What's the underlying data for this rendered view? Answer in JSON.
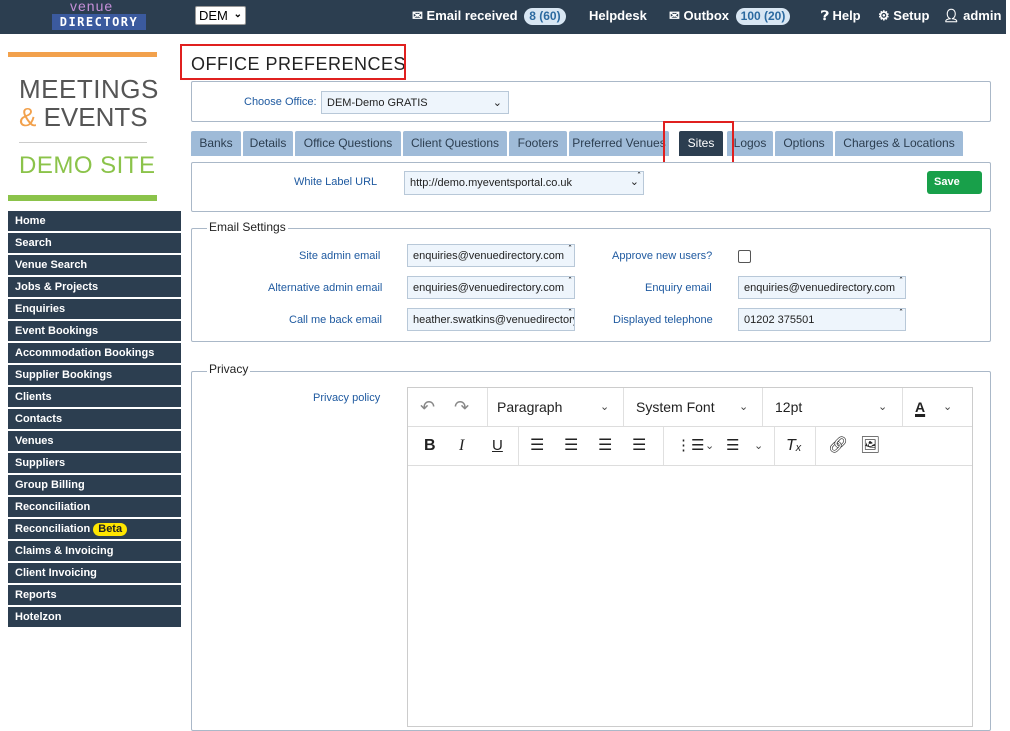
{
  "topbar": {
    "logo_line1": "venue",
    "logo_line2": "DIRECTORY",
    "office_code": "DEM",
    "email_received_label": "Email received",
    "email_received_count": "8 (60)",
    "helpdesk_label": "Helpdesk",
    "outbox_label": "Outbox",
    "outbox_count": "100 (20)",
    "help_label": "Help",
    "setup_label": "Setup",
    "admin_label": "admin"
  },
  "brand": {
    "line1": "MEETINGS",
    "amp": "&",
    "line2": "EVENTS",
    "line3": "DEMO SITE"
  },
  "sidebar": {
    "items": [
      {
        "label": "Home"
      },
      {
        "label": "Search"
      },
      {
        "label": "Venue Search"
      },
      {
        "label": "Jobs & Projects"
      },
      {
        "label": "Enquiries"
      },
      {
        "label": "Event Bookings"
      },
      {
        "label": "Accommodation Bookings"
      },
      {
        "label": "Supplier Bookings"
      },
      {
        "label": "Clients"
      },
      {
        "label": "Contacts"
      },
      {
        "label": "Venues"
      },
      {
        "label": "Suppliers"
      },
      {
        "label": "Group Billing"
      },
      {
        "label": "Reconciliation"
      },
      {
        "label": "Reconciliation",
        "badge": "Beta"
      },
      {
        "label": "Claims & Invoicing"
      },
      {
        "label": "Client Invoicing"
      },
      {
        "label": "Reports"
      },
      {
        "label": "Hotelzon"
      }
    ]
  },
  "main": {
    "title": "OFFICE PREFERENCES",
    "choose_office_label": "Choose Office:",
    "choose_office_value": "DEM-Demo GRATIS",
    "tabs": [
      {
        "label": "Banks"
      },
      {
        "label": "Details"
      },
      {
        "label": "Office Questions"
      },
      {
        "label": "Client Questions"
      },
      {
        "label": "Footers"
      },
      {
        "label": "Preferred Venues"
      },
      {
        "label": "Sites"
      },
      {
        "label": "Logos"
      },
      {
        "label": "Options"
      },
      {
        "label": "Charges & Locations"
      }
    ],
    "white_label_url_label": "White Label URL",
    "white_label_url_value": "http://demo.myeventsportal.co.uk",
    "save_label": "Save",
    "email_settings": {
      "legend": "Email Settings",
      "site_admin_email_label": "Site admin email",
      "site_admin_email_value": "enquiries@venuedirectory.com",
      "approve_new_users_label": "Approve new users?",
      "alternative_admin_email_label": "Alternative admin email",
      "alternative_admin_email_value": "enquiries@venuedirectory.com",
      "enquiry_email_label": "Enquiry email",
      "enquiry_email_value": "enquiries@venuedirectory.com",
      "call_me_back_email_label": "Call me back email",
      "call_me_back_email_value": "heather.swatkins@venuedirectory",
      "displayed_telephone_label": "Displayed telephone",
      "displayed_telephone_value": "01202 375501"
    },
    "privacy": {
      "legend": "Privacy",
      "policy_label": "Privacy policy",
      "block_format": "Paragraph",
      "font_family": "System Font",
      "font_size": "12pt"
    }
  },
  "colors": {
    "topbar": "#2c3e50",
    "tab": "#9fbbd8",
    "tab_active": "#2c3e50",
    "save": "#18a04a",
    "brand_orange": "#f2a14c",
    "brand_green": "#8bc34a",
    "highlight_red": "#e0201f"
  }
}
